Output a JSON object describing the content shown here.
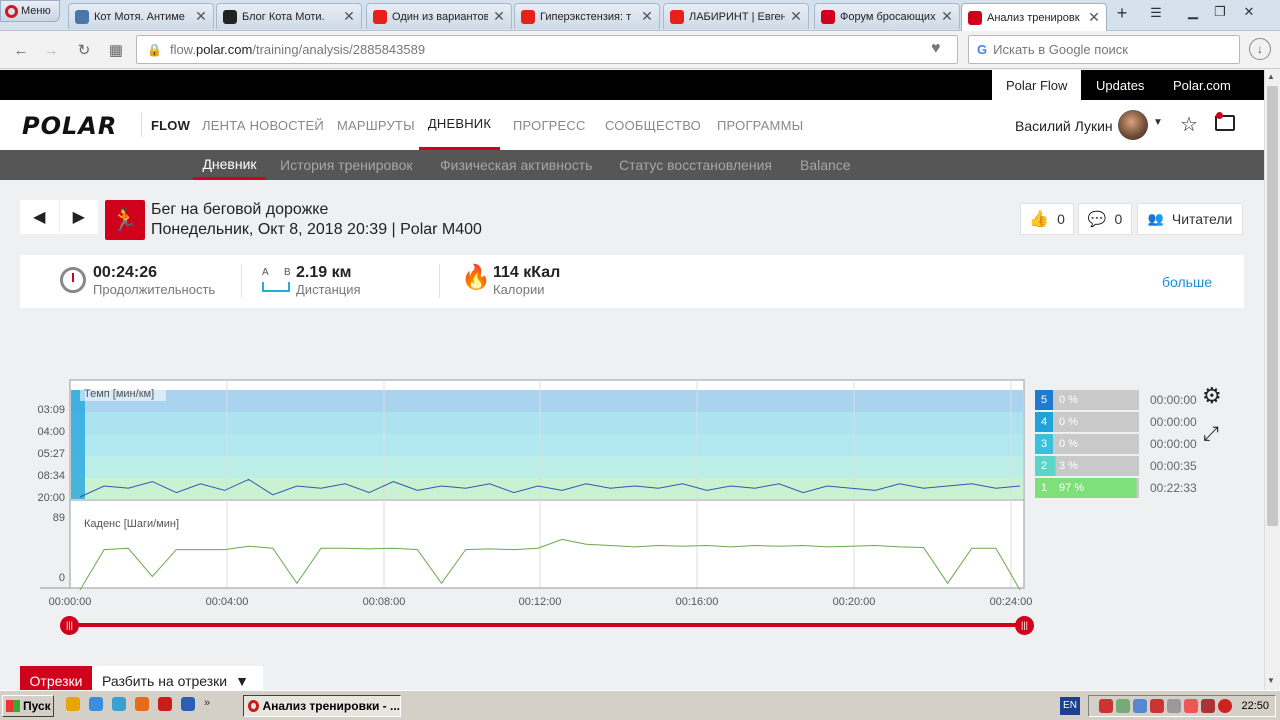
{
  "browser": {
    "menu_label": "Меню",
    "tabs": [
      {
        "title": "Кот Мотя. Антиме",
        "favicon": "vk-icon",
        "color": "#4a76a8"
      },
      {
        "title": "Блог Кота Моти.",
        "favicon": "cat-icon",
        "color": "#222222"
      },
      {
        "title": "Один из вариантов",
        "favicon": "youtube-icon",
        "color": "#e62117"
      },
      {
        "title": "Гиперэкстензия: т",
        "favicon": "youtube-icon",
        "color": "#e62117"
      },
      {
        "title": "ЛАБИРИНТ | Евген",
        "favicon": "youtube-icon",
        "color": "#e62117"
      },
      {
        "title": "Форум бросающих",
        "favicon": "forum-icon",
        "color": "#d0021b"
      },
      {
        "title": "Анализ тренировк",
        "favicon": "polar-icon",
        "color": "#d0021b",
        "active": true
      }
    ],
    "url_host": "flow.polar.com",
    "url_path": "/training/analysis/2885843589",
    "url_prefix": "flow.",
    "url_domain": "polar.com",
    "search_placeholder": "Искать в Google поиск"
  },
  "topstrip": {
    "links": [
      "Polar Flow",
      "Updates",
      "Polar.com"
    ]
  },
  "nav": {
    "logo": "POLAR",
    "flow": "FLOW",
    "items": [
      "ЛЕНТА НОВОСТЕЙ",
      "МАРШРУТЫ",
      "ДНЕВНИК",
      "ПРОГРЕСС",
      "СООБЩЕСТВО",
      "ПРОГРАММЫ"
    ],
    "user": "Василий Лукин"
  },
  "subnav": {
    "items": [
      "Дневник",
      "История тренировок",
      "Физическая активность",
      "Статус восстановления",
      "Balance"
    ]
  },
  "session": {
    "sport": "Бег на беговой дорожке",
    "date": "Понедельник, Окт 8, 2018 20:39 | Polar M400",
    "likes": "0",
    "comments": "0",
    "readers": "Читатели"
  },
  "summary": {
    "duration": {
      "value": "00:24:26",
      "label": "Продолжительность"
    },
    "distance": {
      "value": "2.19 км",
      "label": "Дистанция",
      "a": "A",
      "b": "B"
    },
    "calories": {
      "value": "114 кКал",
      "label": "Калории"
    },
    "more": "больше"
  },
  "chart_data": [
    {
      "type": "line",
      "title": "Темп [мин/км]",
      "y_ticks": [
        "03:09",
        "04:00",
        "05:27",
        "08:34",
        "20:00"
      ],
      "x_ticks": [
        "00:00:00",
        "00:04:00",
        "00:08:00",
        "00:12:00",
        "00:16:00",
        "00:20:00",
        "00:24:00"
      ],
      "series": [
        {
          "values": [
            10.0,
            10.5,
            10.4,
            10.7,
            10.2,
            10.6,
            10.3,
            10.8,
            10.1,
            10.5,
            10.4,
            10.6,
            10.2,
            10.7,
            10.3,
            10.5,
            10.4,
            10.6,
            10.2,
            10.5,
            10.3,
            10.6,
            10.4,
            10.5,
            10.4,
            10.6,
            10.3,
            10.5,
            10.4,
            10.6,
            10.2,
            10.5,
            10.4,
            10.3,
            10.6,
            10.4,
            10.5,
            10.6,
            10.4,
            10.5
          ]
        }
      ]
    },
    {
      "type": "line",
      "title": "Каденс [Шаги/мин]",
      "y_ticks": [
        "89",
        "0"
      ],
      "series": [
        {
          "values": [
            0,
            60,
            62,
            20,
            60,
            60,
            60,
            65,
            62,
            10,
            62,
            62,
            61,
            62,
            60,
            10,
            60,
            61,
            60,
            62,
            75,
            68,
            66,
            64,
            66,
            65,
            66,
            64,
            66,
            65,
            66,
            64,
            65,
            66,
            64,
            63,
            10,
            62,
            62,
            0
          ]
        }
      ]
    }
  ],
  "zones": [
    {
      "n": "5",
      "pct": "0 %",
      "time": "00:00:00",
      "color": "#1f7bd0",
      "fill": 0
    },
    {
      "n": "4",
      "pct": "0 %",
      "time": "00:00:00",
      "color": "#21a2d8",
      "fill": 0
    },
    {
      "n": "3",
      "pct": "0 %",
      "time": "00:00:00",
      "color": "#38c1dc",
      "fill": 0
    },
    {
      "n": "2",
      "pct": "3 %",
      "time": "00:00:35",
      "color": "#5cd4c8",
      "fill": 0.03
    },
    {
      "n": "1",
      "pct": "97 %",
      "time": "00:22:33",
      "color": "#7de07a",
      "fill": 0.97
    }
  ],
  "segments": {
    "tab": "Отрезки",
    "split": "Разбить на отрезки"
  },
  "taskbar": {
    "start": "Пуск",
    "task": "Анализ тренировки - ...",
    "lang": "EN",
    "clock": "22:50"
  }
}
